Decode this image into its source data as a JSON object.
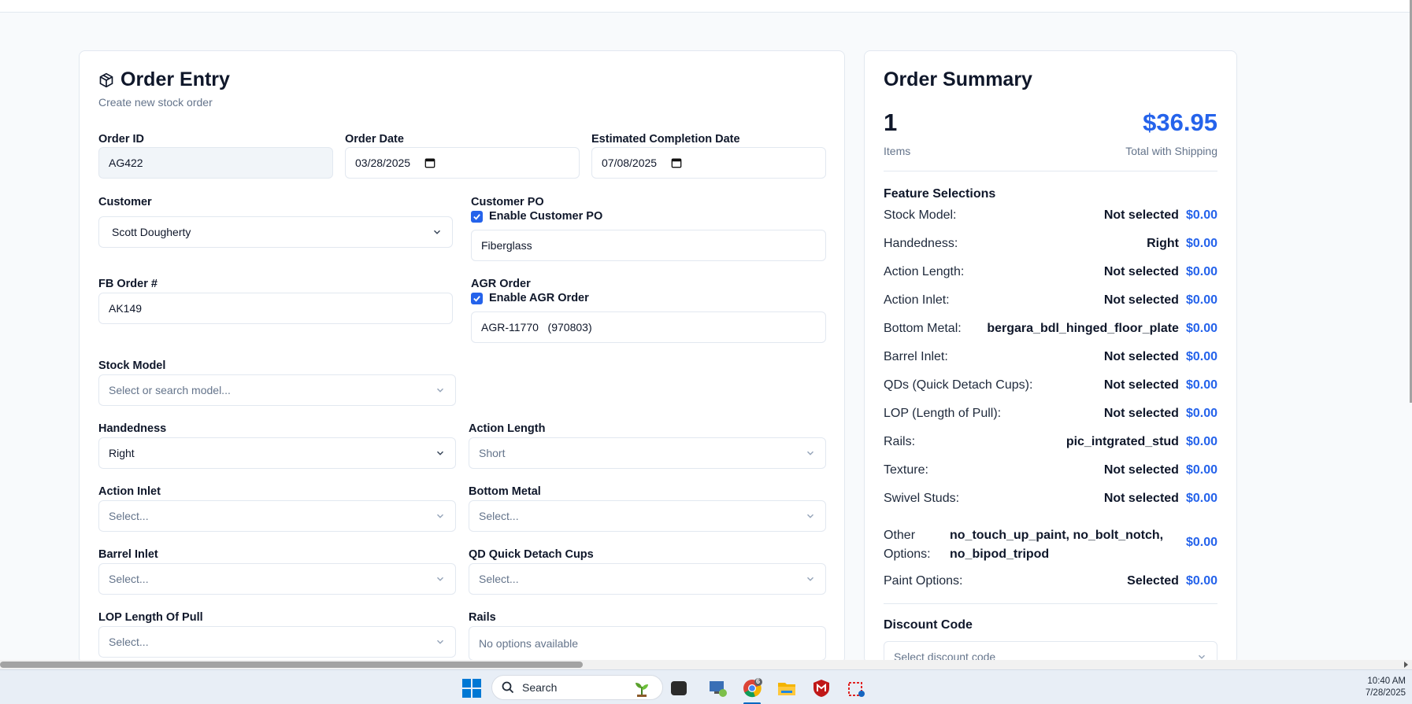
{
  "entry": {
    "title": "Order Entry",
    "subtitle": "Create new stock order",
    "order_id": {
      "label": "Order ID",
      "value": "AG422"
    },
    "order_date": {
      "label": "Order Date",
      "value": "03/28/2025"
    },
    "completion_date": {
      "label": "Estimated Completion Date",
      "value": "07/08/2025"
    },
    "customer": {
      "label": "Customer",
      "value": "Scott Dougherty"
    },
    "customer_po": {
      "label": "Customer PO",
      "checkbox_label": "Enable Customer PO",
      "checked": true,
      "value": "Fiberglass"
    },
    "fb_order": {
      "label": "FB Order #",
      "value": "AK149"
    },
    "agr_order": {
      "label": "AGR Order",
      "checkbox_label": "Enable AGR Order",
      "checked": true,
      "value": "AGR-11770   (970803)"
    },
    "stock_model": {
      "label": "Stock Model",
      "placeholder": "Select or search model..."
    },
    "handedness": {
      "label": "Handedness",
      "value": "Right"
    },
    "action_length": {
      "label": "Action Length",
      "value": "Short"
    },
    "action_inlet": {
      "label": "Action Inlet",
      "placeholder": "Select..."
    },
    "bottom_metal": {
      "label": "Bottom Metal",
      "placeholder": "Select..."
    },
    "barrel_inlet": {
      "label": "Barrel Inlet",
      "placeholder": "Select..."
    },
    "qd_cups": {
      "label": "QD Quick Detach Cups",
      "placeholder": "Select..."
    },
    "lop": {
      "label": "LOP Length Of Pull",
      "placeholder": "Select..."
    },
    "rails": {
      "label": "Rails",
      "placeholder": "No options available"
    }
  },
  "summary": {
    "title": "Order Summary",
    "items_count": "1",
    "items_label": "Items",
    "total": "$36.95",
    "total_label": "Total with Shipping",
    "features_title": "Feature Selections",
    "features": [
      {
        "label": "Stock Model:",
        "value": "Not selected",
        "price": "$0.00"
      },
      {
        "label": "Handedness:",
        "value": "Right",
        "price": "$0.00"
      },
      {
        "label": "Action Length:",
        "value": "Not selected",
        "price": "$0.00"
      },
      {
        "label": "Action Inlet:",
        "value": "Not selected",
        "price": "$0.00"
      },
      {
        "label": "Bottom Metal:",
        "value": "bergara_bdl_hinged_floor_plate",
        "price": "$0.00"
      },
      {
        "label": "Barrel Inlet:",
        "value": "Not selected",
        "price": "$0.00"
      },
      {
        "label": "QDs (Quick Detach Cups):",
        "value": "Not selected",
        "price": "$0.00"
      },
      {
        "label": "LOP (Length of Pull):",
        "value": "Not selected",
        "price": "$0.00"
      },
      {
        "label": "Rails:",
        "value": "pic_intgrated_stud",
        "price": "$0.00"
      },
      {
        "label": "Texture:",
        "value": "Not selected",
        "price": "$0.00"
      },
      {
        "label": "Swivel Studs:",
        "value": "Not selected",
        "price": "$0.00"
      }
    ],
    "other_options": {
      "label_line1": "Other",
      "label_line2": "Options:",
      "value_line1": "no_touch_up_paint, no_bolt_notch,",
      "value_line2": "no_bipod_tripod",
      "price": "$0.00"
    },
    "paint_options": {
      "label": "Paint Options:",
      "value": "Selected",
      "price": "$0.00"
    },
    "discount": {
      "label": "Discount Code",
      "placeholder": "Select discount code"
    }
  },
  "taskbar": {
    "search_label": "Search",
    "chrome_badge": "6",
    "time": "10:40 AM",
    "date": "7/28/2025"
  },
  "colors": {
    "accent": "#2563eb",
    "border": "#e2e8f0",
    "muted": "#64748b"
  }
}
